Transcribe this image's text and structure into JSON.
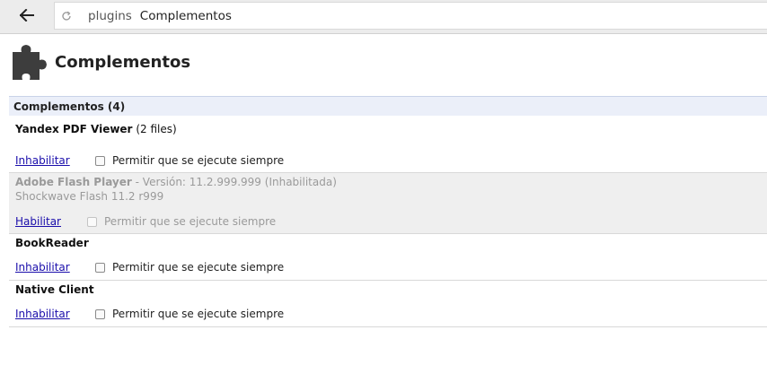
{
  "toolbar": {
    "back_icon": "arrow-left-icon",
    "reload_icon": "reload-icon",
    "url_prefix": "plugins",
    "url_title": "Complementos"
  },
  "header": {
    "icon": "puzzle-icon",
    "title": "Complementos"
  },
  "section": {
    "title": "Complementos (4)"
  },
  "plugins": [
    {
      "name": "Yandex PDF Viewer",
      "files": "(2 files)",
      "action": "Inhabilitar",
      "always_run": "Permitir que se ejecute siempre"
    },
    {
      "name": "Adobe Flash Player",
      "version": "- Versión: 11.2.999.999 (Inhabilitada)",
      "description": "Shockwave Flash 11.2 r999",
      "action": "Habilitar",
      "always_run": "Permitir que se ejecute siempre"
    },
    {
      "name": "BookReader",
      "action": "Inhabilitar",
      "always_run": "Permitir que se ejecute siempre"
    },
    {
      "name": "Native Client",
      "action": "Inhabilitar",
      "always_run": "Permitir que se ejecute siempre"
    }
  ]
}
